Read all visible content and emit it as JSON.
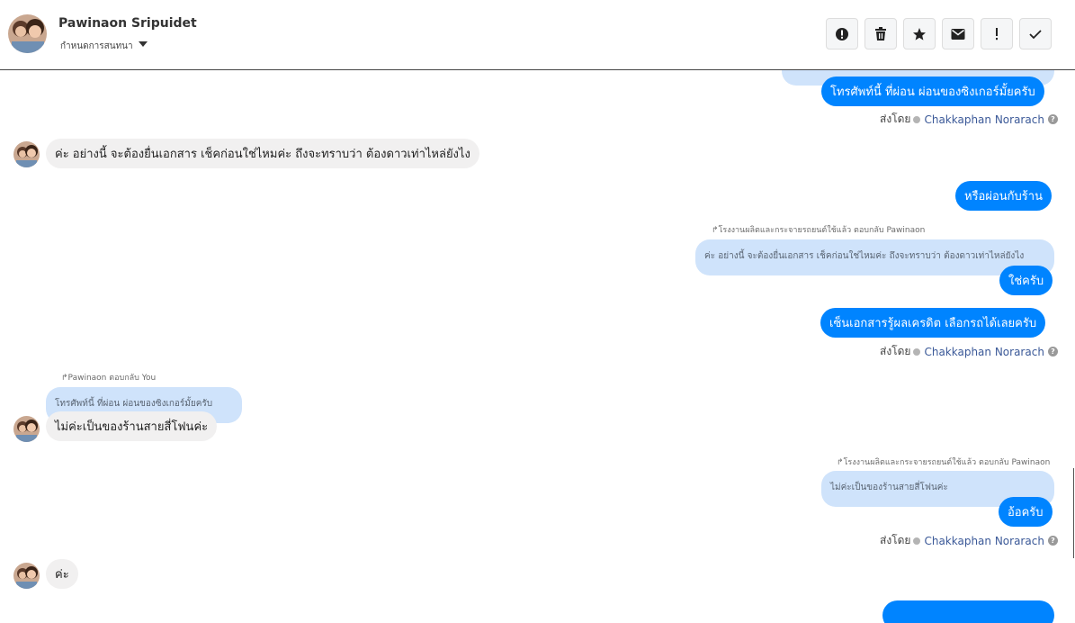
{
  "header": {
    "name": "Pawinaon Sripuidet",
    "subtitle": "กำหนดการสนทนา",
    "toolbar": [
      {
        "name": "spam-button",
        "icon": "alert-circle-icon"
      },
      {
        "name": "delete-button",
        "icon": "trash-icon"
      },
      {
        "name": "star-button",
        "icon": "star-icon"
      },
      {
        "name": "mark-unread-button",
        "icon": "envelope-icon"
      },
      {
        "name": "important-button",
        "icon": "exclamation-icon"
      },
      {
        "name": "done-button",
        "icon": "check-icon"
      }
    ]
  },
  "messages": {
    "m1": "โทรศัพท์นี้ ที่ผ่อน ผ่อนของซิงเกอร์มั้ยครับ",
    "m2": "ค่ะ อย่างนี้ จะต้องยื่นเอกสาร เช็คก่อนใช่ไหมค่ะ ถึงจะทราบว่า ต้องดาวเท่าไหล่ยังไง",
    "m3": "หรือผ่อนกับร้าน",
    "m4_reply_label": "โรงงานผลิตและกระจายรถยนต์ใช้แล้ว ตอบกลับ Pawinaon",
    "m4_quote": "ค่ะ อย่างนี้ จะต้องยื่นเอกสาร เช็คก่อนใช่ไหมค่ะ ถึงจะทราบว่า ต้องดาวเท่าไหล่ยังไง",
    "m4": "ใช่ครับ",
    "m5": "เซ็นเอกสารรู้ผลเครดิต เลือกรถได้เลยครับ",
    "m6_reply_label": "Pawinaon ตอบกลับ You",
    "m6_quote": "โทรศัพท์นี้ ที่ผ่อน ผ่อนของซิงเกอร์มั้ยครับ",
    "m6": "ไม่ค่ะเป็นของร้านสายสี่โฟนค่ะ",
    "m7_reply_label": "โรงงานผลิตและกระจายรถยนต์ใช้แล้ว ตอบกลับ Pawinaon",
    "m7_quote": "ไม่ค่ะเป็นของร้านสายสี่โฟนค่ะ",
    "m7": "อ้อครับ",
    "m8": "ค่ะ"
  },
  "sent_by": {
    "label": "ส่งโดย",
    "sender": "Chakkaphan Norarach",
    "help": "?"
  },
  "colors": {
    "outgoing": "#0084ff",
    "incoming": "#f1f0f0",
    "quote": "#cfe3fb",
    "sender_link": "#3b5998"
  }
}
